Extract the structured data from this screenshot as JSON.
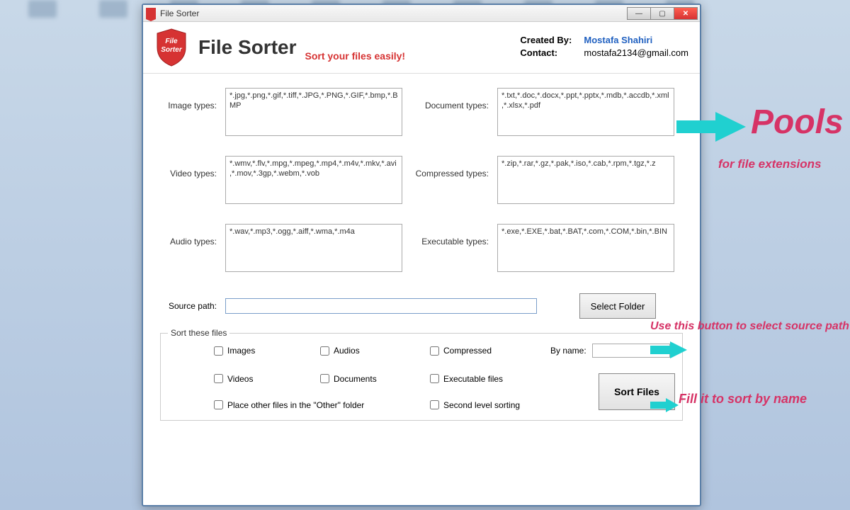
{
  "window": {
    "title": "File Sorter"
  },
  "header": {
    "app_title": "File Sorter",
    "tagline": "Sort your files easily!",
    "shield_text_top": "File",
    "shield_text_bottom": "Sorter",
    "created_by_label": "Created By:",
    "created_by_value": "Mostafa Shahiri",
    "contact_label": "Contact:",
    "contact_value": "mostafa2134@gmail.com"
  },
  "pools": {
    "image_label": "Image types:",
    "image_value": "*.jpg,*.png,*.gif,*.tiff,*.JPG,*.PNG,*.GIF,*.bmp,*.BMP",
    "document_label": "Document types:",
    "document_value": "*.txt,*.doc,*.docx,*.ppt,*.pptx,*.mdb,*.accdb,*.xml,*.xlsx,*.pdf",
    "video_label": "Video types:",
    "video_value": "*.wmv,*.flv,*.mpg,*.mpeg,*.mp4,*.m4v,*.mkv,*.avi,*.mov,*.3gp,*.webm,*.vob",
    "compressed_label": "Compressed types:",
    "compressed_value": "*.zip,*.rar,*.gz,*.pak,*.iso,*.cab,*.rpm,*.tgz,*.z",
    "audio_label": "Audio types:",
    "audio_value": "*.wav,*.mp3,*.ogg,*.aiff,*.wma,*.m4a",
    "executable_label": "Executable types:",
    "executable_value": "*.exe,*.EXE,*.bat,*.BAT,*.com,*.COM,*.bin,*.BIN"
  },
  "source": {
    "label": "Source path:",
    "value": "",
    "button": "Select Folder"
  },
  "sortbox": {
    "title": "Sort these files",
    "images": "Images",
    "audios": "Audios",
    "compressed": "Compressed",
    "byname_label": "By name:",
    "byname_value": "",
    "videos": "Videos",
    "documents": "Documents",
    "executable": "Executable files",
    "other": "Place other files in the \"Other\" folder",
    "second_level": "Second level sorting",
    "sort_button": "Sort Files"
  },
  "annotations": {
    "pools_title": "Pools",
    "pools_sub": "for file extensions",
    "select_hint": "Use this button to select source path",
    "byname_hint": "Fill it to sort by name"
  }
}
